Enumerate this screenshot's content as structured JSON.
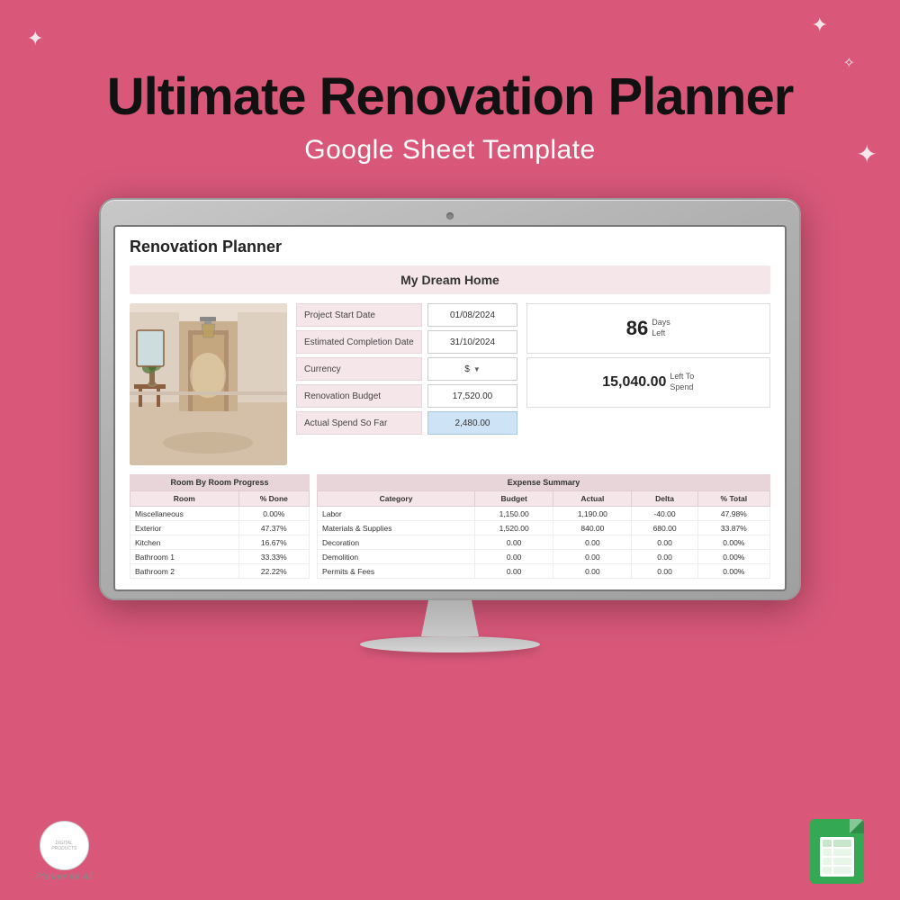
{
  "page": {
    "title": "Ultimate Renovation Planner",
    "subtitle": "Google Sheet Template"
  },
  "app": {
    "title": "Renovation Planner",
    "project_name": "My Dream Home",
    "fields": {
      "project_start_label": "Project Start Date",
      "project_start_value": "01/08/2024",
      "completion_label": "Estimated Completion Date",
      "completion_value": "31/10/2024",
      "currency_label": "Currency",
      "currency_value": "$",
      "budget_label": "Renovation Budget",
      "budget_value": "17,520.00",
      "actual_spend_label": "Actual Spend So Far",
      "actual_spend_value": "2,480.00"
    },
    "stats": {
      "days_number": "86",
      "days_label": "Days\nLeft",
      "spend_number": "15,040.00",
      "spend_label": "Left To\nSpend"
    },
    "room_progress": {
      "header": "Room By Room Progress",
      "col_room": "Room",
      "col_done": "% Done",
      "rows": [
        {
          "room": "Miscellaneous",
          "done": "0.00%"
        },
        {
          "room": "Exterior",
          "done": "47.37%"
        },
        {
          "room": "Kitchen",
          "done": "16.67%"
        },
        {
          "room": "Bathroom 1",
          "done": "33.33%"
        },
        {
          "room": "Bathroom 2",
          "done": "22.22%"
        }
      ]
    },
    "expense_summary": {
      "header": "Expense Summary",
      "cols": [
        "Category",
        "Budget",
        "Actual",
        "Delta",
        "% Total"
      ],
      "rows": [
        {
          "category": "Labor",
          "budget": "1,150.00",
          "actual": "1,190.00",
          "delta": "-40.00",
          "pct": "47.98%"
        },
        {
          "category": "Materials & Supplies",
          "budget": "1,520.00",
          "actual": "840.00",
          "delta": "680.00",
          "pct": "33.87%"
        },
        {
          "category": "Decoration",
          "budget": "0.00",
          "actual": "0.00",
          "delta": "0.00",
          "pct": "0.00%"
        },
        {
          "category": "Demolition",
          "budget": "0.00",
          "actual": "0.00",
          "delta": "0.00",
          "pct": "0.00%"
        },
        {
          "category": "Permits & Fees",
          "budget": "0.00",
          "actual": "0.00",
          "delta": "0.00",
          "pct": "0.00%"
        }
      ]
    }
  },
  "logos": {
    "planner_name": "Planner for All",
    "planner_tagline": "DIGITAL PRODUCTS"
  }
}
